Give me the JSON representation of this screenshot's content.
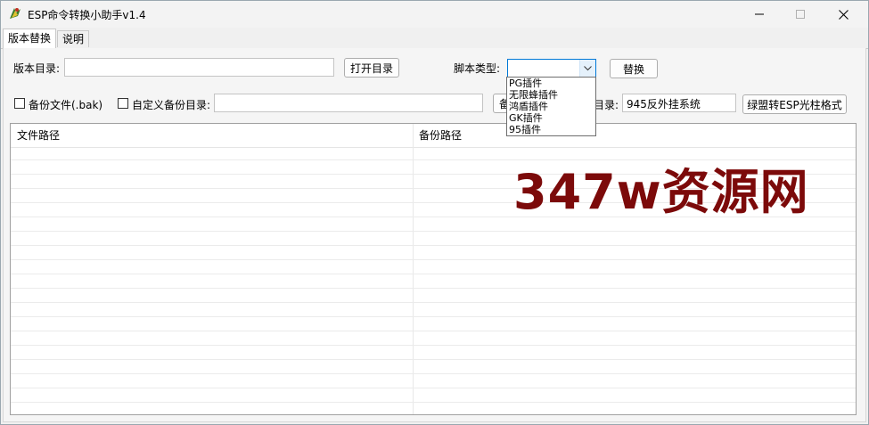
{
  "window": {
    "title": "ESP命令转换小助手v1.4"
  },
  "tabs": [
    {
      "label": "版本替换"
    },
    {
      "label": "说明"
    }
  ],
  "row1": {
    "version_dir_label": "版本目录:",
    "version_dir_value": "",
    "open_dir_button": "打开目录",
    "script_type_label": "脚本类型:",
    "script_type_value": "",
    "replace_button": "替换"
  },
  "script_type_options": [
    "PG插件",
    "无限蜂插件",
    "鸿盾插件",
    "GK插件",
    "95插件"
  ],
  "row2": {
    "backup_file_label": "备份文件(.bak)",
    "custom_backup_label": "自定义备份目录:",
    "custom_backup_value": "",
    "partial_button_text": "备",
    "partial_label_text": "目录:",
    "dir_value": "945反外挂系统",
    "convert_button": "绿盟转ESP光柱格式"
  },
  "table": {
    "columns": [
      "文件路径",
      "备份路径"
    ],
    "rows": []
  },
  "watermark": {
    "text": "347w资源网",
    "color": "#7c0a0a"
  },
  "colors": {
    "accent": "#0078d7"
  }
}
